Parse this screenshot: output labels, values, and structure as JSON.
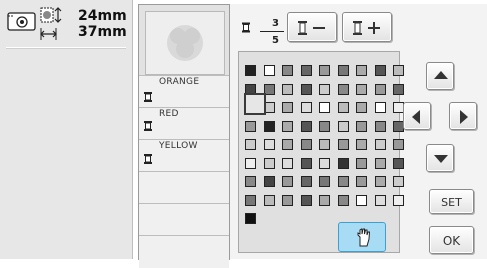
{
  "info": {
    "width": "24mm",
    "height": "37mm"
  },
  "threads": {
    "fraction_numerator": "3",
    "fraction_denominator": "5",
    "items": [
      "ORANGE",
      "RED",
      "YELLOW"
    ]
  },
  "buttons": {
    "set_label": "SET",
    "ok_label": "OK"
  },
  "icons": {
    "minus": "spool-minus-icon",
    "plus": "spool-plus-icon",
    "hand": "hand-icon",
    "up": "arrow-up-icon",
    "down": "arrow-down-icon",
    "left": "arrow-left-icon",
    "right": "arrow-right-icon"
  },
  "colors": {
    "accent": "#a8dcf5",
    "panel": "#e2e2e2"
  }
}
